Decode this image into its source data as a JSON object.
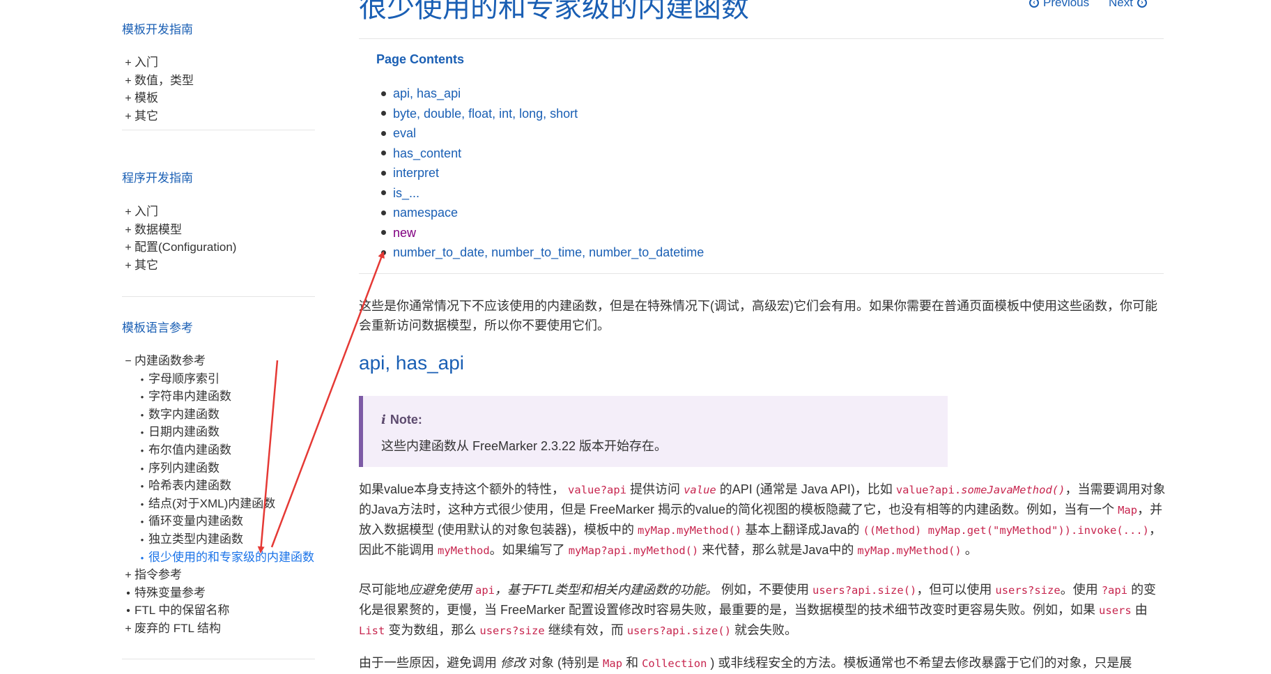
{
  "sidebar": {
    "sections": [
      {
        "title": "模板开发指南",
        "items": [
          {
            "marker": "+",
            "label": "入门"
          },
          {
            "marker": "+",
            "label": "数值，类型"
          },
          {
            "marker": "+",
            "label": "模板"
          },
          {
            "marker": "+",
            "label": "其它"
          }
        ]
      },
      {
        "title": "程序开发指南",
        "items": [
          {
            "marker": "+",
            "label": "入门"
          },
          {
            "marker": "+",
            "label": "数据模型"
          },
          {
            "marker": "+",
            "label": "配置(Configuration)"
          },
          {
            "marker": "+",
            "label": "其它"
          }
        ]
      },
      {
        "title": "模板语言参考",
        "items": [
          {
            "marker": "−",
            "label": "内建函数参考"
          },
          {
            "marker": "+",
            "label": "指令参考"
          },
          {
            "marker": "•",
            "label": "特殊变量参考"
          },
          {
            "marker": "•",
            "label": "FTL 中的保留名称"
          },
          {
            "marker": "+",
            "label": "废弃的 FTL 结构"
          }
        ],
        "sub_items": [
          "字母顺序索引",
          "字符串内建函数",
          "数字内建函数",
          "日期内建函数",
          "布尔值内建函数",
          "序列内建函数",
          "哈希表内建函数",
          "结点(对于XML)内建函数",
          "循环变量内建函数",
          "独立类型内建函数",
          "很少使用的和专家级的内建函数"
        ]
      }
    ]
  },
  "main": {
    "page_title": "很少使用的和专家级的内建函数",
    "pager": {
      "previous": "Previous",
      "next": "Next"
    },
    "toc": {
      "title": "Page Contents",
      "items": [
        "api, has_api",
        "byte, double, float, int, long, short",
        "eval",
        "has_content",
        "interpret",
        "is_...",
        "namespace",
        "new",
        "number_to_date, number_to_time, number_to_datetime"
      ]
    },
    "intro": "这些是你通常情况下不应该使用的内建函数，但是在特殊情况下(调试，高级宏)它们会有用。如果你需要在普通页面模板中使用这些函数，你可能会重新访问数据模型，所以你不要使用它们。",
    "section_heading": "api, has_api",
    "note": {
      "title": "Note:",
      "text": "这些内建函数从 FreeMarker 2.3.22 版本开始存在。"
    },
    "para1": {
      "t1": "如果value本身支持这个额外的特性，",
      "c1": "value?api",
      "t2": "提供访问",
      "c2": "value",
      "t3": "的API (通常是 Java API)，比如",
      "c3a": "value?api.",
      "c3b": "someJavaMethod()",
      "t4": "，当需要调用对象的Java方法时，这种方式很少使用，但是 FreeMarker 揭示的value的简化视图的模板隐藏了它，也没有相等的内建函数。例如，当有一个",
      "c4": "Map",
      "t5": "，并放入数据模型 (使用默认的对象包装器)，模板中的",
      "c5": "myMap.myMethod()",
      "t6": "基本上翻译成Java的",
      "c6": "((Method) myMap.get(\"myMethod\")).invoke(...)",
      "t7": "，因此不能调用",
      "c7": "myMethod",
      "t8": "。如果编写了",
      "c8": "myMap?api.myMethod()",
      "t9": "来代替，那么就是Java中的",
      "c9": "myMap.myMethod()",
      "t10": "。"
    },
    "para2": {
      "t1": "尽可能地",
      "e1": "应避免使用",
      "c1": "api",
      "e2": "，基于FTL类型和相关内建函数的功能。",
      "t2": "例如，不要使用",
      "c2": "users?api.size()",
      "t3": "，但可以使用",
      "c3": "users?size",
      "t4": "。使用",
      "c4": "?api",
      "t5": "的变化是很累赘的，更慢，当 FreeMarker 配置设置修改时容易失败，最重要的是，当数据模型的技术细节改变时更容易失败。例如，如果",
      "c5": "users",
      "t6": "由",
      "c6": "List",
      "t7": "变为数组，那么",
      "c7": "users?size",
      "t8": "继续有效，而",
      "c8": "users?api.size()",
      "t9": "就会失败。"
    },
    "para3": {
      "t1": "由于一些原因，避免调用",
      "e1": "修改",
      "t2": "对象 (特别是",
      "c1": "Map",
      "t3": "和",
      "c2": "Collection",
      "t4": ") 或非线程安全的方法。模板通常也不希望去修改暴露于它们的对象，只是展"
    }
  },
  "colors": {
    "link": "#1a5fb4",
    "current_item": "#1a73e8",
    "visited": "#800080",
    "code": "#c7254e",
    "note_bg": "#f4eef9",
    "note_border": "#7d5ba6",
    "annotation_arrow": "#e53935"
  }
}
